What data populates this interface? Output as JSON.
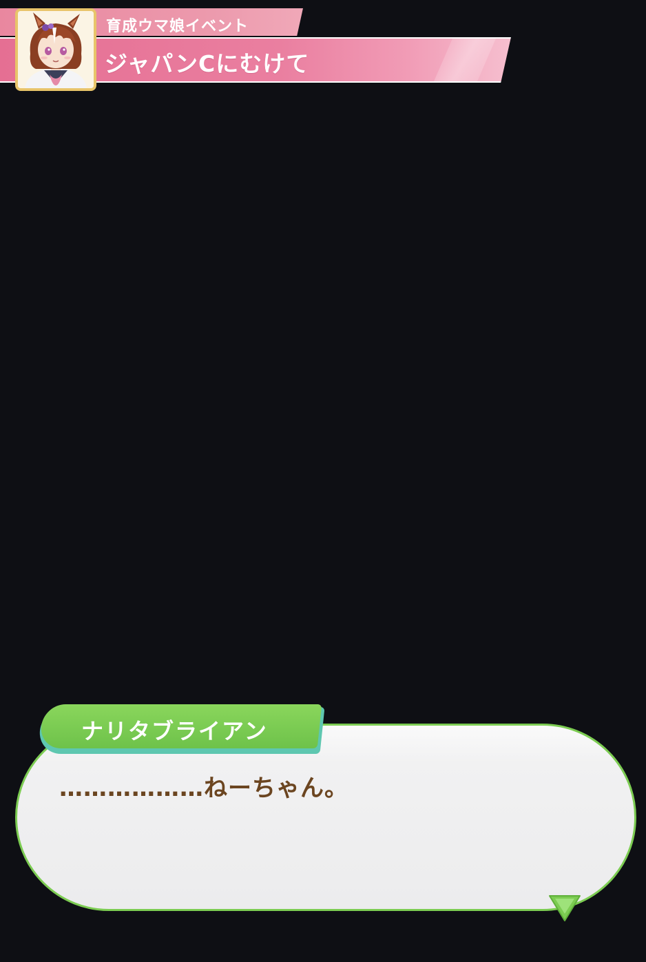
{
  "event": {
    "category": "育成ウマ娘イベント",
    "title": "ジャパンCにむけて"
  },
  "dialogue": {
    "speaker": "ナリタブライアン",
    "text": "………………ねーちゃん。"
  },
  "icons": {
    "portrait": "character-portrait",
    "next": "next-arrow-icon"
  },
  "colors": {
    "background": "#0e0f14",
    "banner_pink": "#e56f93",
    "speaker_green": "#7ccc52",
    "dialogue_text": "#6b4520",
    "portrait_border": "#e8c46a"
  }
}
